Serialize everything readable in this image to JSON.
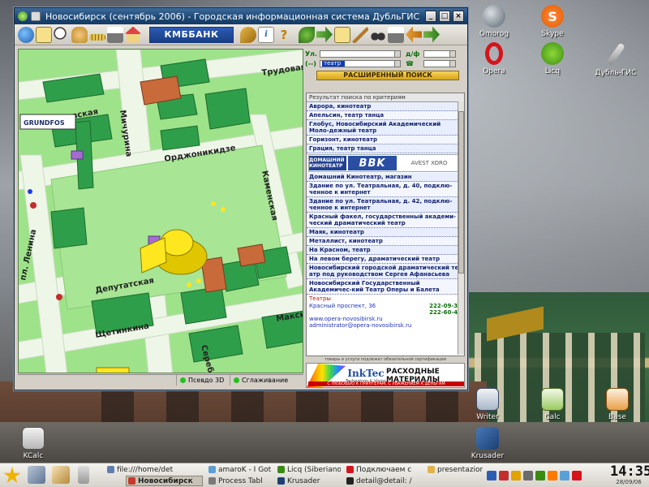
{
  "window": {
    "title": "Новосибирск (сентябрь 2006) - Городская информационная система ДубльГИС",
    "bank_logo": "КМББАНК",
    "btn_min": "_",
    "btn_max": "□",
    "btn_close": "×",
    "tool_info": "i",
    "tool_help": "?"
  },
  "map": {
    "labels": {
      "trudovaya": "Трудовая",
      "michurina": "Мичурина",
      "ordzhonikidze": "Орджоникидзе",
      "kamenskaya": "Каменская",
      "deputatskaya": "Депутатская",
      "shchetinkina": "Щетинкина",
      "maksima": "Максим",
      "serebr": "Сереб",
      "pl_lenina": "пл. Ленина",
      "evskaya": "евская",
      "grundfos": "GRUNDFOS"
    },
    "status": {
      "pseudo3d": "Псевдо 3D",
      "smoothing": "Сглаживание"
    }
  },
  "panel": {
    "street_label": "Ул.",
    "house_label": "д/ф",
    "rubric_label": "(--)",
    "rubric_value": "театр",
    "adv_search": "РАСШИРЕННЫЙ ПОИСК",
    "results_header": "Результат поиска по критериям",
    "results": [
      "Аврора, кинотеатр",
      "Апельсин, театр танца",
      "Глобус, Новосибирский Академический Моло-дежный театр",
      "Горизонт, кинотеатр",
      "Грация, театр танца"
    ],
    "ad_inline": {
      "brand1": "ДОМАШНИЙ КИНОТЕАТР",
      "brand2": "BBK",
      "brand3": "AVEST XORO"
    },
    "results2": [
      "Домашний Кинотеатр, магазин",
      "Здание по ул. Театральная, д. 40, подклю-ченное к интернет",
      "Здание по ул. Театральная, д. 42, подклю-ченное к интернет",
      "Красный факел, государственный академи-ческий драматический театр",
      "Маяк, кинотеатр",
      "Металлист, кинотеатр",
      "На Красном, театр",
      "На левом берегу, драматический театр",
      "Новосибирский городской драматический те-атр под руководством Сергея Афанасьева",
      "Новосибирский Государственный Академичес-кий Театр Оперы и Балета"
    ],
    "section": "Театры",
    "contacts": [
      {
        "text": "Красный проспект, 36",
        "phone": "222-09-34"
      },
      {
        "text": "",
        "phone": "222-60-40"
      },
      {
        "text": "www.opera-novosibirsk.ru",
        "phone": ""
      },
      {
        "text": "administrator@opera-novosibirsk.ru",
        "phone": ""
      }
    ],
    "ad_note": "товары и услуги подлежат обязательной сертификации",
    "ad_banner": {
      "brand": "InkTec",
      "brand_sub": "Technology & Vision",
      "title": "РАСХОДНЫЕ МАТЕРИАЛЫ",
      "slogan": "С ЛЮБОВЬЮ К ПРИНТЕРАМ, С УВАЖЕНИЕМ К ДЕНЬГАМ"
    }
  },
  "desktop_icons": [
    "Omorog",
    "Skype",
    "Opera",
    "Licq",
    "Дубль-ГИС",
    "Writer",
    "Calc",
    "Base",
    "Krusader",
    "KCalc"
  ],
  "taskbar": {
    "tasks_top": [
      "file:///home/det",
      "amaroK - I Got",
      "Licq (Siberiano)",
      "Подключаем с",
      "presentazione"
    ],
    "tasks_bottom": [
      "Новосибирск",
      "Process Tabl",
      "Krusader",
      "detail@detail: /"
    ],
    "time": "14:35",
    "date": "28/09/06"
  }
}
